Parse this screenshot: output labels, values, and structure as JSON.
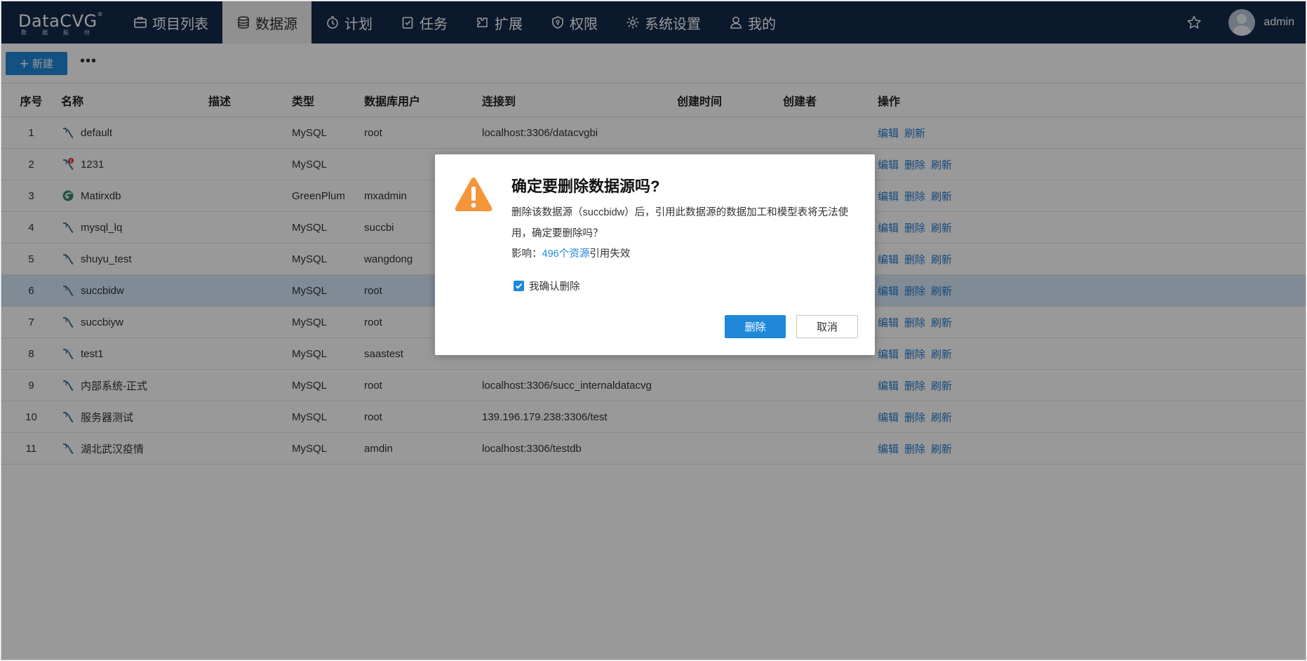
{
  "brand": {
    "name": "DataCVG",
    "sub": "数据股份"
  },
  "nav": [
    {
      "label": "项目列表",
      "icon": "briefcase-icon"
    },
    {
      "label": "数据源",
      "icon": "database-icon",
      "active": true
    },
    {
      "label": "计划",
      "icon": "timer-icon"
    },
    {
      "label": "任务",
      "icon": "clipboard-check-icon"
    },
    {
      "label": "扩展",
      "icon": "puzzle-icon"
    },
    {
      "label": "权限",
      "icon": "shield-icon"
    },
    {
      "label": "系统设置",
      "icon": "gear-icon"
    },
    {
      "label": "我的",
      "icon": "user-icon"
    }
  ],
  "user": {
    "name": "admin"
  },
  "toolbar": {
    "new_label": "新建",
    "more_label": "•••"
  },
  "table": {
    "headers": {
      "no": "序号",
      "name": "名称",
      "desc": "描述",
      "type": "类型",
      "user": "数据库用户",
      "conn": "连接到",
      "time": "创建时间",
      "creator": "创建者",
      "ops": "操作"
    },
    "rows": [
      {
        "no": "1",
        "name": "default",
        "type": "MySQL",
        "user": "root",
        "conn": "localhost:3306/datacvgbi",
        "icon": "mysql-icon",
        "ops": [
          "编辑",
          "刷新"
        ]
      },
      {
        "no": "2",
        "name": "1231",
        "type": "MySQL",
        "user": "",
        "conn": "",
        "icon": "mysql-error-icon",
        "ops": [
          "编辑",
          "删除",
          "刷新"
        ]
      },
      {
        "no": "3",
        "name": "Matirxdb",
        "type": "GreenPlum",
        "user": "mxadmin",
        "conn": "",
        "icon": "greenplum-icon",
        "ops": [
          "编辑",
          "删除",
          "刷新"
        ]
      },
      {
        "no": "4",
        "name": "mysql_lq",
        "type": "MySQL",
        "user": "succbi",
        "conn": "",
        "icon": "mysql-icon",
        "ops": [
          "编辑",
          "删除",
          "刷新"
        ]
      },
      {
        "no": "5",
        "name": "shuyu_test",
        "type": "MySQL",
        "user": "wangdong",
        "conn": "",
        "icon": "mysql-icon",
        "ops": [
          "编辑",
          "删除",
          "刷新"
        ]
      },
      {
        "no": "6",
        "name": "succbidw",
        "type": "MySQL",
        "user": "root",
        "conn": "",
        "icon": "mysql-icon",
        "ops": [
          "编辑",
          "删除",
          "刷新"
        ],
        "selected": true
      },
      {
        "no": "7",
        "name": "succbiyw",
        "type": "MySQL",
        "user": "root",
        "conn": "",
        "icon": "mysql-icon",
        "ops": [
          "编辑",
          "删除",
          "刷新"
        ]
      },
      {
        "no": "8",
        "name": "test1",
        "type": "MySQL",
        "user": "saastest",
        "conn": "",
        "icon": "mysql-icon",
        "ops": [
          "编辑",
          "删除",
          "刷新"
        ]
      },
      {
        "no": "9",
        "name": "内部系统-正式",
        "type": "MySQL",
        "user": "root",
        "conn": "localhost:3306/succ_internaldatacvg",
        "icon": "mysql-icon",
        "ops": [
          "编辑",
          "删除",
          "刷新"
        ]
      },
      {
        "no": "10",
        "name": "服务器测试",
        "type": "MySQL",
        "user": "root",
        "conn": "139.196.179.238:3306/test",
        "icon": "mysql-icon",
        "ops": [
          "编辑",
          "删除",
          "刷新"
        ]
      },
      {
        "no": "11",
        "name": "湖北武汉疫情",
        "type": "MySQL",
        "user": "amdin",
        "conn": "localhost:3306/testdb",
        "icon": "mysql-icon",
        "ops": [
          "编辑",
          "删除",
          "刷新"
        ]
      }
    ]
  },
  "dialog": {
    "title": "确定要删除数据源吗?",
    "message": "删除该数据源（succbidw）后，引用此数据源的数据加工和模型表将无法使用，确定要删除吗？",
    "impact_prefix": "影响：",
    "impact_link": "496个资源",
    "impact_suffix": "引用失效",
    "confirm_label": "我确认删除",
    "confirm_checked": true,
    "delete_label": "删除",
    "cancel_label": "取消"
  },
  "colors": {
    "nav_bg": "#132b4b",
    "accent": "#1f88d9",
    "warning": "#f5953a",
    "selected_row": "#d6e8fb"
  }
}
